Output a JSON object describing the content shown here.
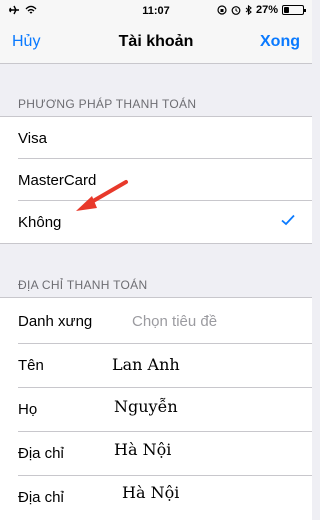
{
  "status_bar": {
    "time": "11:07",
    "battery": "27%",
    "battery_level": 0.27
  },
  "nav": {
    "left": "Hủy",
    "title": "Tài khoản",
    "right": "Xong"
  },
  "payment": {
    "header": "PHƯƠNG PHÁP THANH TOÁN",
    "options": [
      "Visa",
      "MasterCard",
      "Không"
    ],
    "selected_index": 2
  },
  "billing": {
    "header": "ĐỊA CHỈ THANH TOÁN",
    "title_label": "Danh xưng",
    "title_placeholder": "Chọn tiêu đề",
    "first_name_label": "Tên",
    "first_name_value": "Lan Anh",
    "last_name_label": "Họ",
    "last_name_value": "Nguyễn",
    "address1_label": "Địa chỉ",
    "address1_value": "Hà Nội",
    "address2_label": "Địa chỉ",
    "address2_value": "Hà Nội"
  },
  "colors": {
    "accent": "#0a7aff",
    "annotation": "#e8392b",
    "background": "#efeff4"
  }
}
